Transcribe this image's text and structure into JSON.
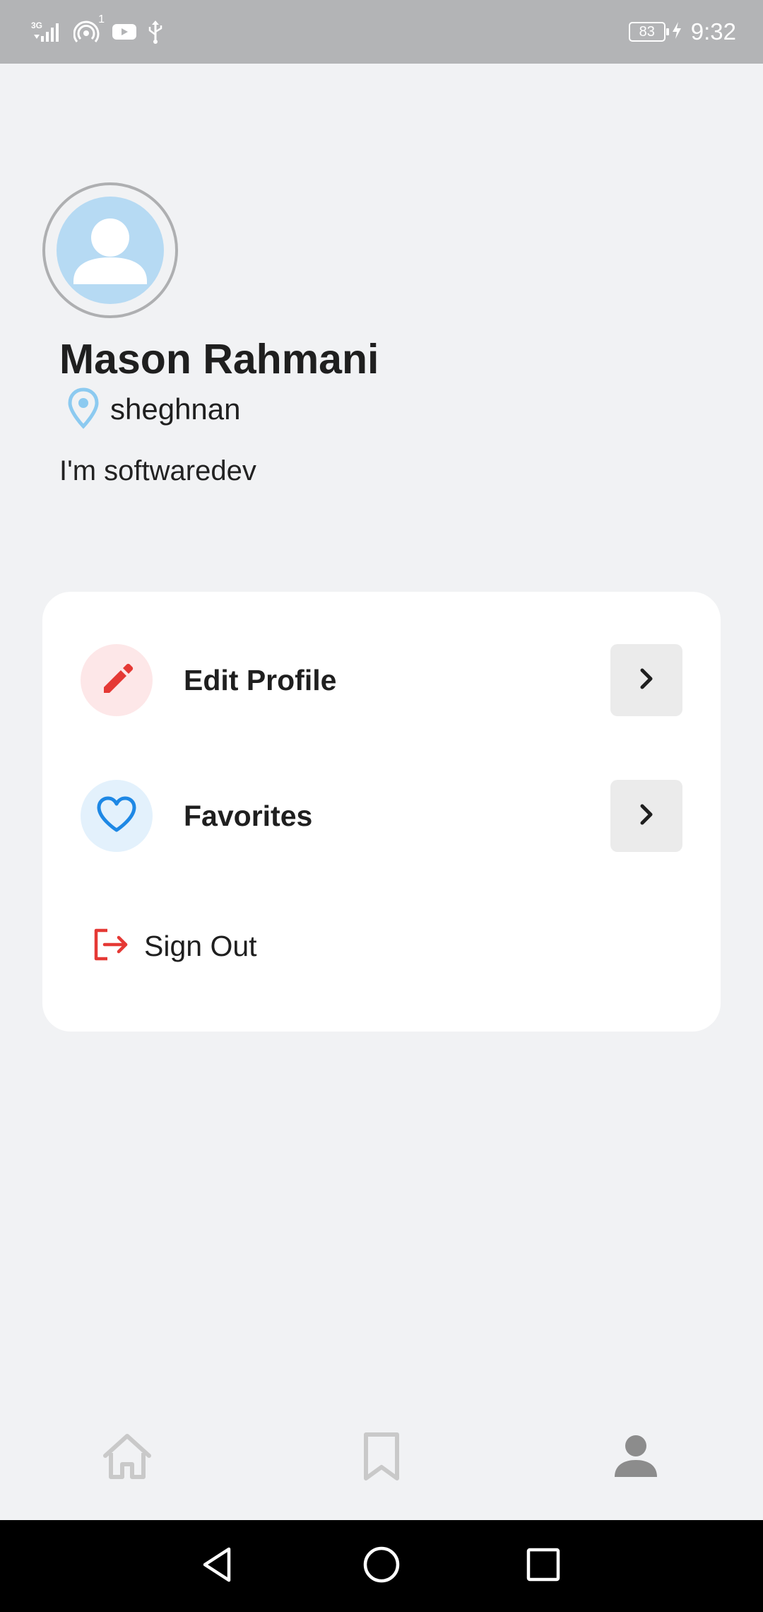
{
  "status_bar": {
    "network": "3G",
    "notification_count": "1",
    "battery_level": "83",
    "time": "9:32",
    "icons": [
      "signal-icon",
      "hotspot-icon",
      "youtube-icon",
      "usb-icon",
      "battery-icon",
      "charging-icon"
    ]
  },
  "profile": {
    "name": "Mason Rahmani",
    "location": "sheghnan",
    "bio": "I'm softwaredev",
    "avatar_icon": "user-avatar-icon"
  },
  "menu": {
    "edit_profile": {
      "label": "Edit Profile",
      "icon": "pencil-icon",
      "icon_color": "#e53935",
      "icon_bg": "#fde7e8"
    },
    "favorites": {
      "label": "Favorites",
      "icon": "heart-icon",
      "icon_color": "#1e88e5",
      "icon_bg": "#e3f1fc"
    },
    "sign_out": {
      "label": "Sign Out",
      "icon": "logout-icon",
      "icon_color": "#e53935"
    }
  },
  "bottom_nav": {
    "items": [
      "home-icon",
      "bookmark-icon",
      "profile-icon"
    ],
    "active": "profile-icon"
  },
  "colors": {
    "background": "#f1f2f4",
    "card": "#ffffff",
    "accent_blue": "#b6daf3",
    "nav_inactive": "#c9c9c9",
    "nav_active": "#8c8c8c"
  }
}
